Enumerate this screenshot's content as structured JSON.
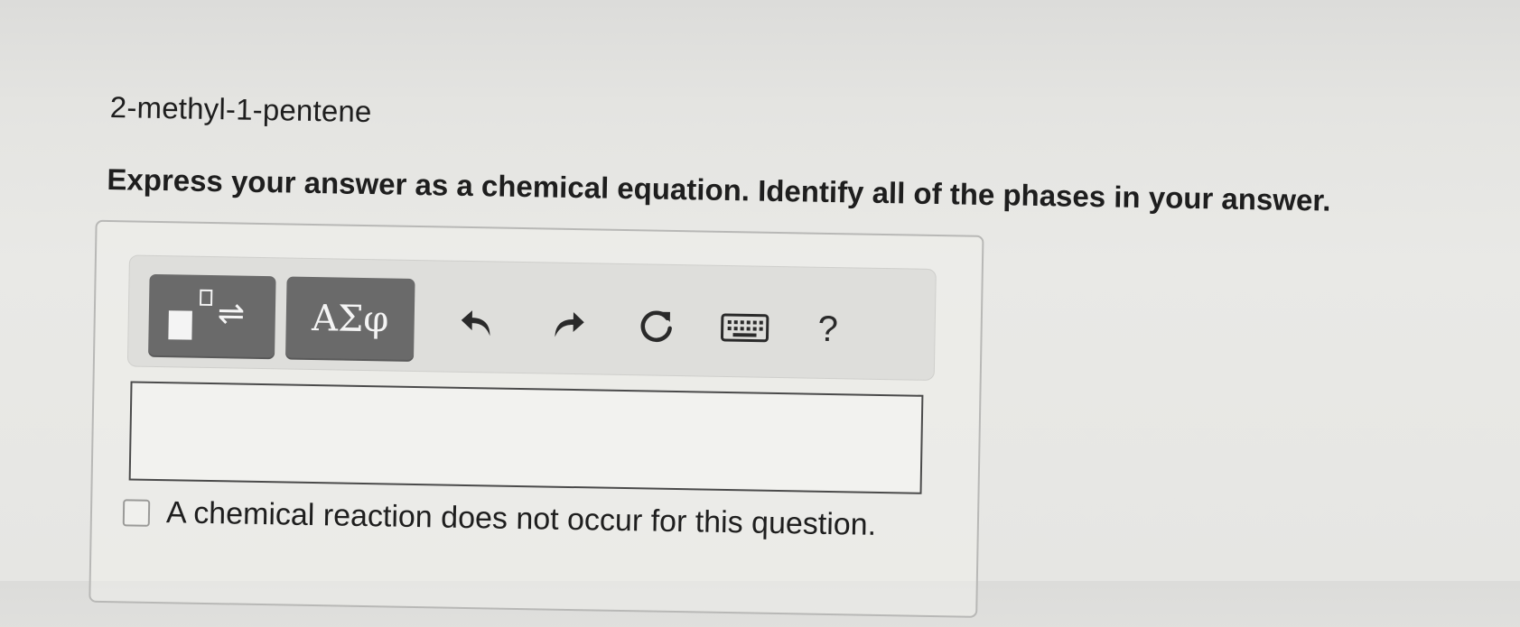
{
  "question": {
    "compound_name": "2-methyl-1-pentene",
    "instruction": "Express your answer as a chemical equation. Identify all of the phases in your answer."
  },
  "toolbar": {
    "templates_icon": "template-superscript-equilibrium-icon",
    "symbols_label": "ΑΣφ",
    "undo_icon": "undo-icon",
    "redo_icon": "redo-icon",
    "reset_icon": "reset-icon",
    "keyboard_icon": "keyboard-icon",
    "help_label": "?"
  },
  "answer_input": {
    "value": ""
  },
  "no_reaction": {
    "checked": false,
    "label": "A chemical reaction does not occur for this question."
  },
  "colors": {
    "button_bg": "#6a6a6a",
    "toolbar_bg": "#dededb",
    "input_border": "#4a4a4a"
  }
}
